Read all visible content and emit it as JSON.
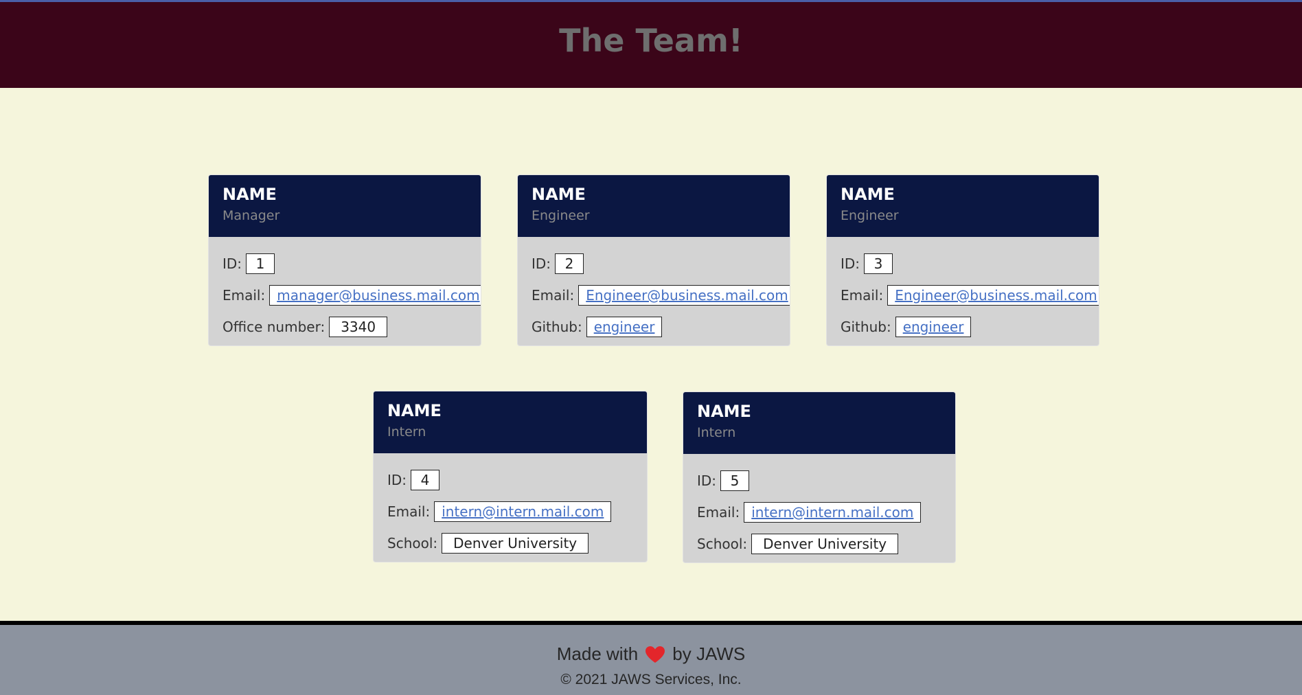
{
  "header": {
    "title": "The Team!"
  },
  "cards": [
    {
      "name": "NAME",
      "role": "Manager",
      "id": "1",
      "email": "manager@business.mail.com",
      "extra_label": "Office number:",
      "extra_value": "3340"
    },
    {
      "name": "NAME",
      "role": "Engineer",
      "id": "2",
      "email": "Engineer@business.mail.com",
      "extra_label": "Github:",
      "extra_value": "engineer"
    },
    {
      "name": "NAME",
      "role": "Engineer",
      "id": "3",
      "email": "Engineer@business.mail.com",
      "extra_label": "Github:",
      "extra_value": "engineer"
    },
    {
      "name": "NAME",
      "role": "Intern",
      "id": "4",
      "email": "intern@intern.mail.com",
      "extra_label": "School:",
      "extra_value": "Denver University"
    },
    {
      "name": "NAME",
      "role": "Intern",
      "id": "5",
      "email": "intern@intern.mail.com",
      "extra_label": "School:",
      "extra_value": "Denver University"
    }
  ],
  "labels": {
    "id": "ID:",
    "email": "Email:"
  },
  "footer": {
    "made_with": "Made with",
    "by": "by JAWS",
    "heart_icon": "heart-icon",
    "copyright": "© 2021 JAWS Services, Inc."
  },
  "colors": {
    "header_bg": "#3b0519",
    "card_head_bg": "#0b1742",
    "page_bg": "#f5f5dc",
    "footer_bg": "#8c939f",
    "link": "#4570c4",
    "heart": "#e3262b"
  }
}
